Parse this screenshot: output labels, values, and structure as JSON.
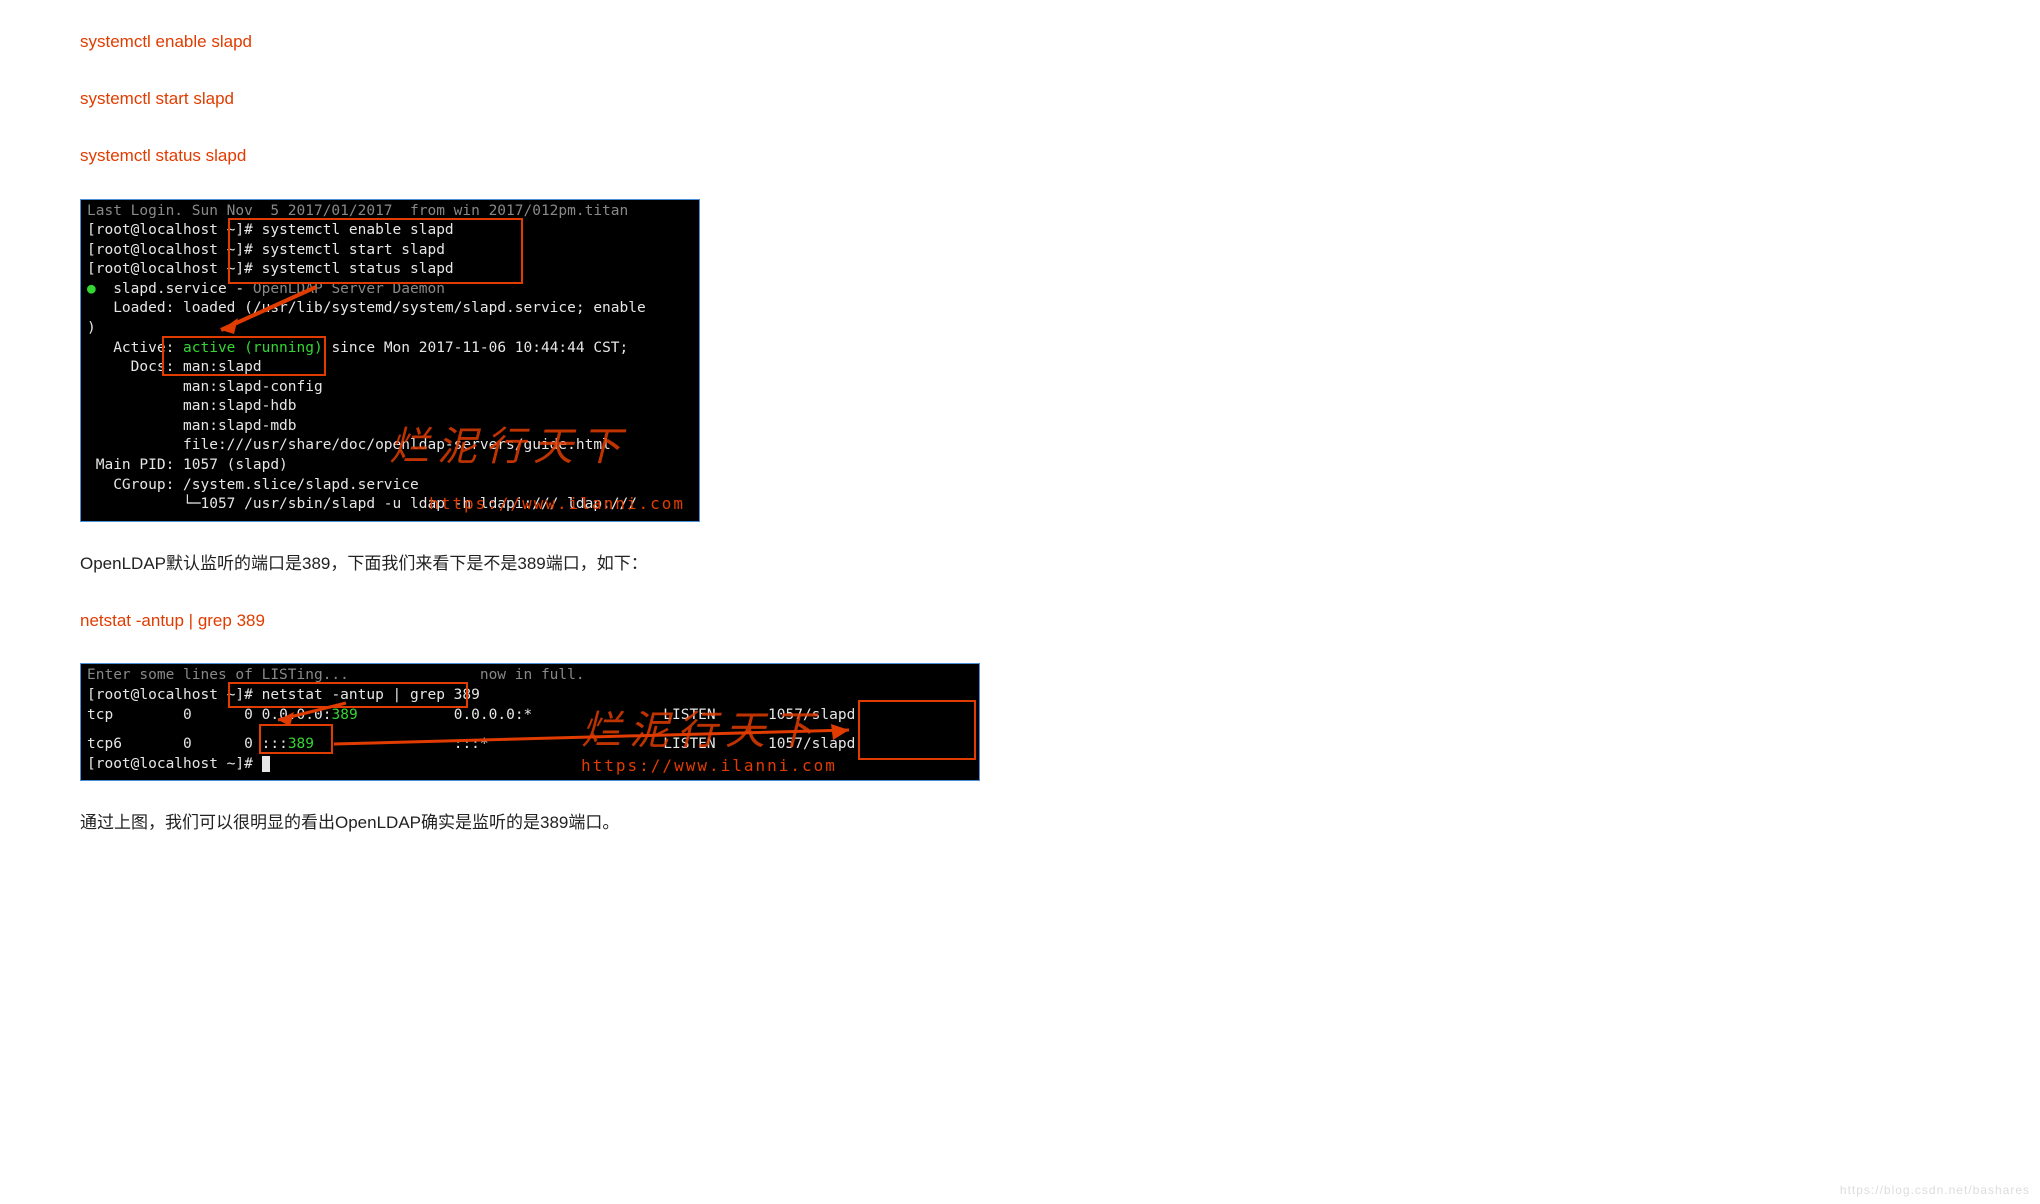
{
  "commands": {
    "c1": "systemctl enable slapd",
    "c2": "systemctl start slapd",
    "c3": "systemctl status slapd",
    "c4": "netstat -antup | grep 389"
  },
  "paragraphs": {
    "p1": "OpenLDAP默认监听的端口是389，下面我们来看下是不是389端口，如下：",
    "p2": "通过上图，我们可以很明显的看出OpenLDAP确实是监听的是389端口。"
  },
  "terminal1": {
    "l0": "Last Login. Sun Nov  5 2017/01/2017  from win 2017/012pm.titan",
    "l1a": "[root@localhost ~]# ",
    "l1b": "systemctl enable slapd",
    "l2a": "[root@localhost ~]# ",
    "l2b": "systemctl start slapd",
    "l3a": "[root@localhost ~]# ",
    "l3b": "systemctl status slapd",
    "dot": "●",
    "l4a": "  slapd.service - ",
    "l4b": "OpenLDAP Server Daemon",
    "l5": "   Loaded: loaded (/usr/lib/systemd/system/slapd.service; enable",
    "l5b": ")",
    "l6a": "   Active: ",
    "l6b": "active (running)",
    "l6c": " since Mon 2017-11-06 10:44:44 CST;  ",
    "l7": "     Docs: man:slapd",
    "l8": "           man:slapd-config",
    "l9": "           man:slapd-hdb",
    "l10": "           man:slapd-mdb",
    "l11": "           file:///usr/share/doc/openldap-servers/guide.html",
    "l12": " Main PID: 1057 (slapd)",
    "l13": "   CGroup: /system.slice/slapd.service",
    "l14": "           └─1057 /usr/sbin/slapd -u ldap -h ldapi:/// ldap:///"
  },
  "terminal2": {
    "l0header": "Enter some lines of LISTing...               now in full.",
    "l1a": "[root@localhost ~]# ",
    "l1b": "netstat -antup | grep 389",
    "row1": {
      "proto": "tcp",
      "recv": "0",
      "send": "0",
      "local_a": "0.0.0.0:",
      "local_b": "389",
      "foreign": "0.0.0.0:*",
      "state": "LISTEN",
      "proc": "1057/slapd"
    },
    "row2": {
      "proto": "tcp6",
      "recv": "0",
      "send": "0",
      "local_a": ":::",
      "local_b": "389",
      "foreign": ":::*",
      "state": "LISTEN",
      "proc": "1057/slapd"
    },
    "last": "[root@localhost ~]# "
  },
  "watermark": {
    "cn": "烂泥行天下",
    "url": "https://www.ilanni.com"
  },
  "footer_wm": "https://blog.csdn.net/bashares"
}
